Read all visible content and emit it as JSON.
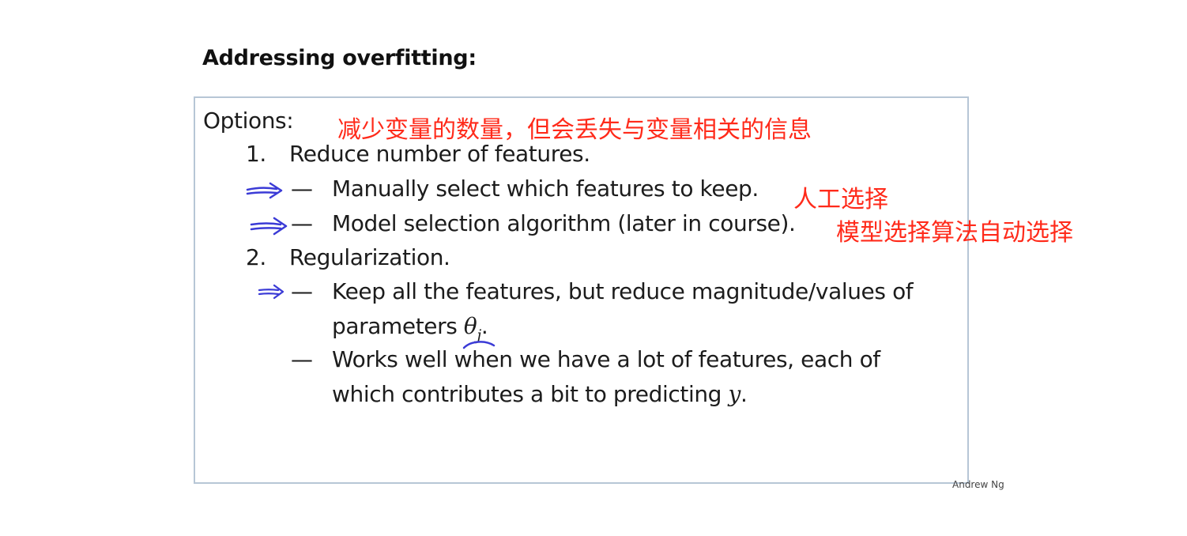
{
  "slide": {
    "title": "Addressing overfitting:",
    "options_label": "Options:",
    "option1": {
      "number": "1.",
      "text": "Reduce number of features.",
      "bullets": [
        {
          "dash": "—",
          "text": "Manually select which features to keep."
        },
        {
          "dash": "—",
          "text": "Model selection algorithm (later in course)."
        }
      ]
    },
    "option2": {
      "number": "2.",
      "text": "Regularization.",
      "bullet1": {
        "dash": "—",
        "line1": "Keep all the features, but reduce magnitude/values of",
        "line2_prefix": "parameters ",
        "math_theta": "θ",
        "math_sub": "j",
        "line2_suffix": "."
      },
      "bullet2": {
        "dash": "—",
        "line1": "Works well when we have a lot of features, each of",
        "line2_prefix": "which contributes a bit to predicting ",
        "math_y": "y",
        "line2_suffix": "."
      }
    },
    "credit": "Andrew Ng"
  },
  "annotations": {
    "note_top": "减少变量的数量，但会丢失与变量相关的信息",
    "note_manual": "人工选择",
    "note_model": "模型选择算法自动选择",
    "ink_color": "#3b3bd6",
    "note_color": "#ff2a1a"
  }
}
